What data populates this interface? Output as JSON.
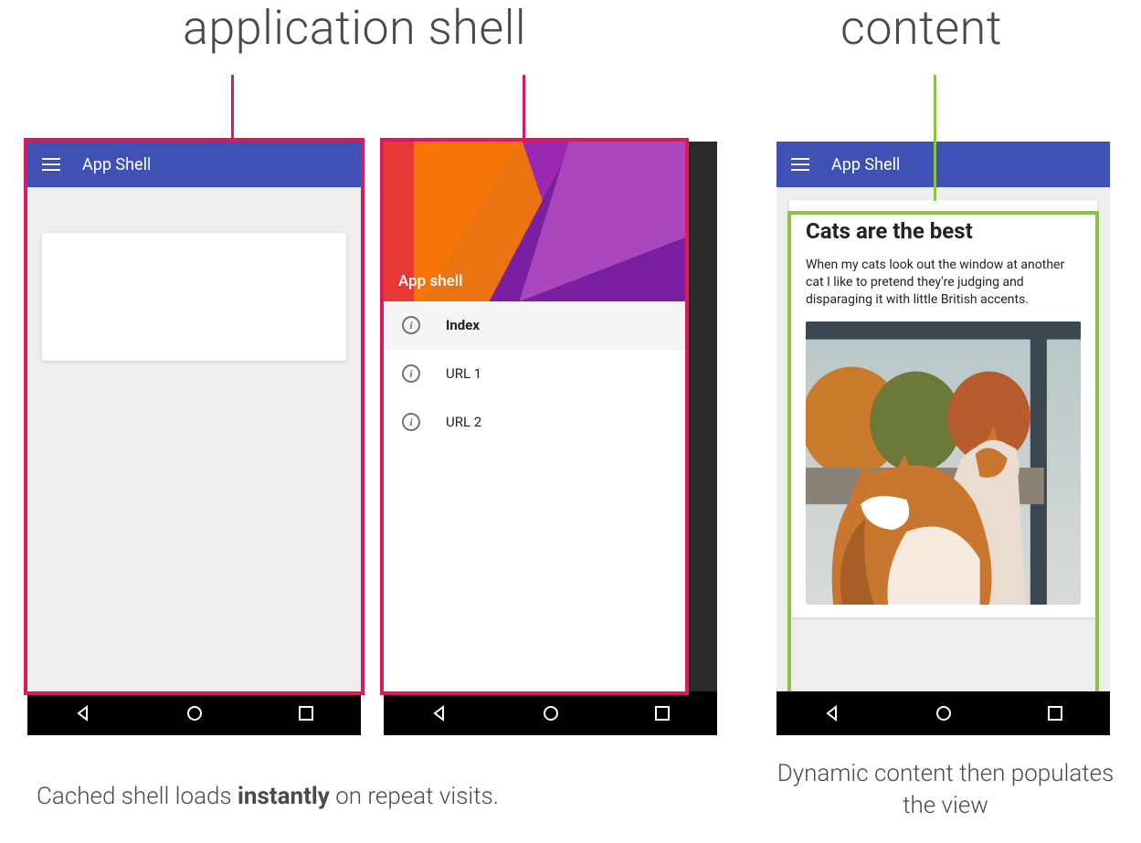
{
  "headings": {
    "shell": "application shell",
    "content": "content"
  },
  "colors": {
    "highlight_shell": "#d81b60",
    "highlight_content": "#8bc34a",
    "appbar": "#3f51b5"
  },
  "phone1": {
    "appbar_title": "App Shell"
  },
  "phone2": {
    "drawer_header_label": "App shell",
    "items": [
      {
        "label": "Index",
        "active": true
      },
      {
        "label": "URL 1",
        "active": false
      },
      {
        "label": "URL 2",
        "active": false
      }
    ]
  },
  "phone3": {
    "appbar_title": "App Shell",
    "article": {
      "title": "Cats are the best",
      "body": "When my cats look out the window at another cat I like to pretend they're judging and disparaging it with little British accents."
    }
  },
  "captions": {
    "left_pre": "Cached shell loads ",
    "left_bold": "instantly",
    "left_post": " on repeat visits.",
    "right": "Dynamic content then populates the view"
  }
}
